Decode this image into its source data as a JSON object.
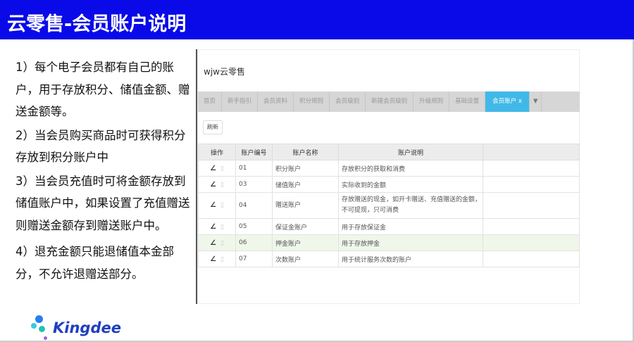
{
  "title": "云零售-会员账户说明",
  "notes": [
    "1）每个电子会员都有自己的账户，用于存放积分、储值金额、赠送金额等。",
    "2）当会员购买商品时可获得积分存放到积分账户中",
    "3）当会员充值时可将金额存放到储值账户中，如果设置了充值赠送则赠送金额存到赠送账户中。",
    "4）退充金额只能退储值本金部分，不允许退赠送部分。"
  ],
  "app": {
    "title": "wjw云零售",
    "tabs": [
      "首页",
      "新手指引",
      "会员资料",
      "积分规则",
      "会员级别",
      "新建会员级别",
      "升级规则",
      "基础设置"
    ],
    "active_tab": "会员账户  x",
    "refresh": "刷新",
    "columns": [
      "操作",
      "账户编号",
      "账户名称",
      "账户说明",
      ""
    ],
    "rows": [
      {
        "code": "01",
        "name": "积分账户",
        "desc": "存放积分的获取和消费"
      },
      {
        "code": "03",
        "name": "储值账户",
        "desc": "实际收到的金额"
      },
      {
        "code": "04",
        "name": "赠送账户",
        "desc": "存放赠送的现金，如开卡赠送、充值赠送的金额，不可提现，只可消费"
      },
      {
        "code": "05",
        "name": "保证金账户",
        "desc": "用于存放保证金"
      },
      {
        "code": "06",
        "name": "押金账户",
        "desc": "用于存放押金"
      },
      {
        "code": "07",
        "name": "次数账户",
        "desc": "用于统计服务次数的账户"
      }
    ]
  },
  "logo": "Kingdee"
}
